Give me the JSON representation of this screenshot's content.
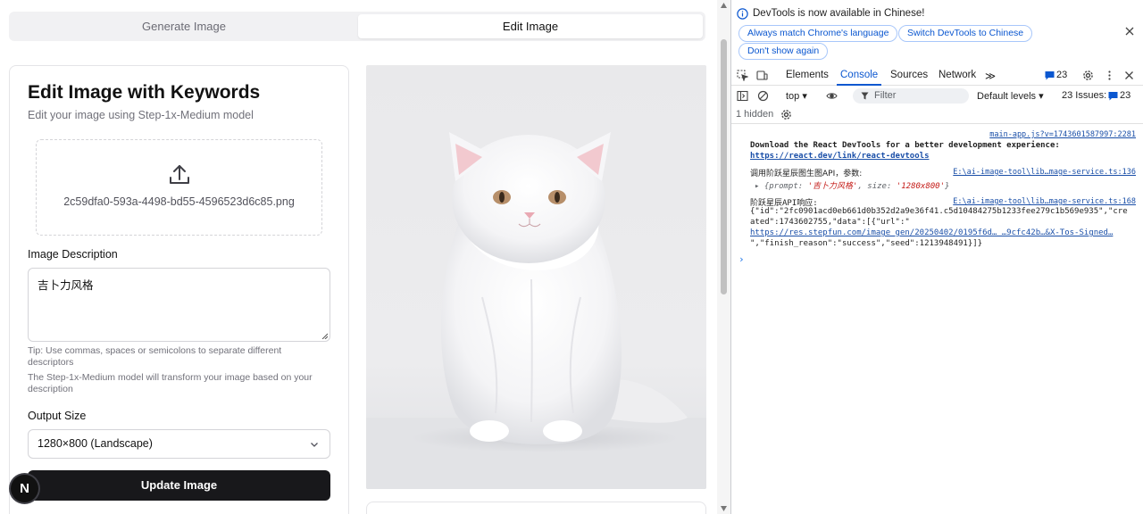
{
  "tabs": {
    "generate": "Generate Image",
    "edit": "Edit Image"
  },
  "card": {
    "title": "Edit Image with Keywords",
    "subtitle": "Edit your image using Step-1x-Medium model",
    "file_name": "2c59dfa0-593a-4498-bd55-4596523d6c85.png",
    "desc_label": "Image Description",
    "desc_value": "吉卜力风格",
    "tip1": "Tip: Use commas, spaces or semicolons to separate different descriptors",
    "tip2": "The Step-1x-Medium model will transform your image based on your description",
    "size_label": "Output Size",
    "size_value": "1280×800 (Landscape)",
    "button": "Update Image"
  },
  "next_badge": "N",
  "devtools": {
    "info": "DevTools is now available in Chinese!",
    "pill_match": "Always match Chrome's language",
    "pill_switch": "Switch DevTools to Chinese",
    "pill_dont": "Don't show again",
    "tabs": [
      "Elements",
      "Console",
      "Sources",
      "Network"
    ],
    "more": "≫",
    "msg_count": "23",
    "context": "top ▾",
    "filter": "Filter",
    "levels": "Default levels ▾",
    "issues_label": "23 Issues:",
    "issues_count": "23",
    "hidden": "1 hidden",
    "logs": {
      "src1": "main-app.js?v=1743601587997:2281",
      "react1": "Download the React DevTools for a better development experience:",
      "react2": "https://react.dev/link/react-devtools",
      "call": "调用阶跃星辰图生图API，参数:",
      "src2": "E:\\ai-image-tool\\lib…mage-service.ts:136",
      "obj_prefix": "▸ {prompt: ",
      "obj_prompt": "'吉卜力风格'",
      "obj_mid": ", size: ",
      "obj_size": "'1280x800'",
      "obj_suffix": "}",
      "resp": "阶跃星辰API响应:",
      "src3": "E:\\ai-image-tool\\lib…mage-service.ts:168",
      "resp1": "{\"id\":\"2fc0901acd0eb661d0b352d2a9e36f41.c5d10484275b1233fee279c1b569e935\",\"cre",
      "resp2": "ated\":1743602755,\"data\":[{\"url\":\"",
      "resp3": "https://res.stepfun.com/image_gen/20250402/0195f6d… …9cfc42b…&X-Tos-Signed…",
      "resp4": "\",\"finish_reason\":\"success\",\"seed\":1213948491}]}",
      "prompt": "›"
    }
  }
}
